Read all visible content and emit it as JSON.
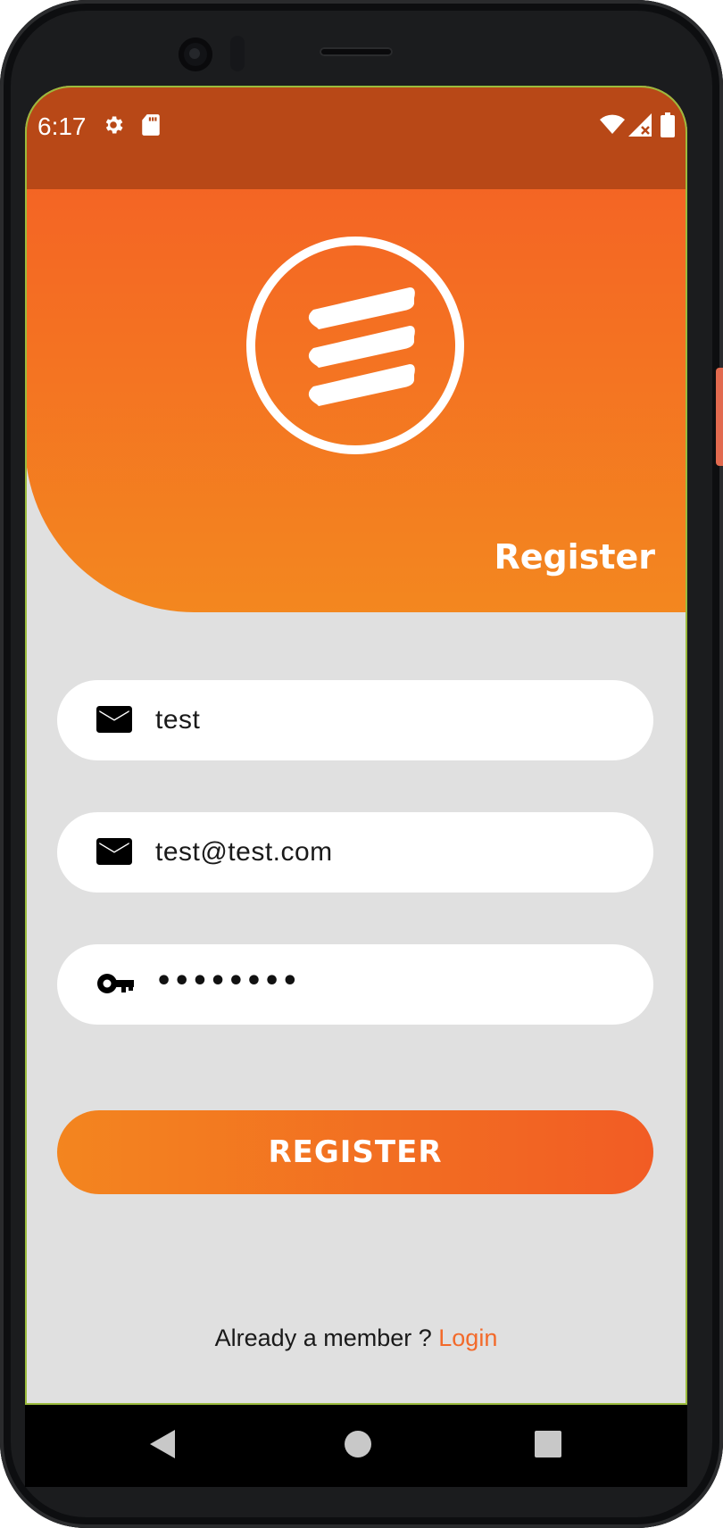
{
  "status_bar": {
    "time": "6:17",
    "icons": [
      "gear-icon",
      "sd-card-icon",
      "wifi-icon",
      "signal-icon",
      "battery-icon"
    ]
  },
  "header": {
    "logo": "brand-logo",
    "title": "Register"
  },
  "form": {
    "username": {
      "value": "test",
      "icon": "mail-icon"
    },
    "email": {
      "value": "test@test.com",
      "icon": "mail-icon"
    },
    "password": {
      "value": "••••••••",
      "icon": "key-icon"
    }
  },
  "register_button": {
    "label": "REGISTER"
  },
  "footer": {
    "prompt": "Already a member ? ",
    "link": "Login"
  },
  "nav": [
    "back-icon",
    "home-icon",
    "recents-icon"
  ],
  "colors": {
    "accent": "#f46524",
    "accent_light": "#f3871f",
    "status_bar": "#b84817",
    "background": "#e0e0e0"
  }
}
